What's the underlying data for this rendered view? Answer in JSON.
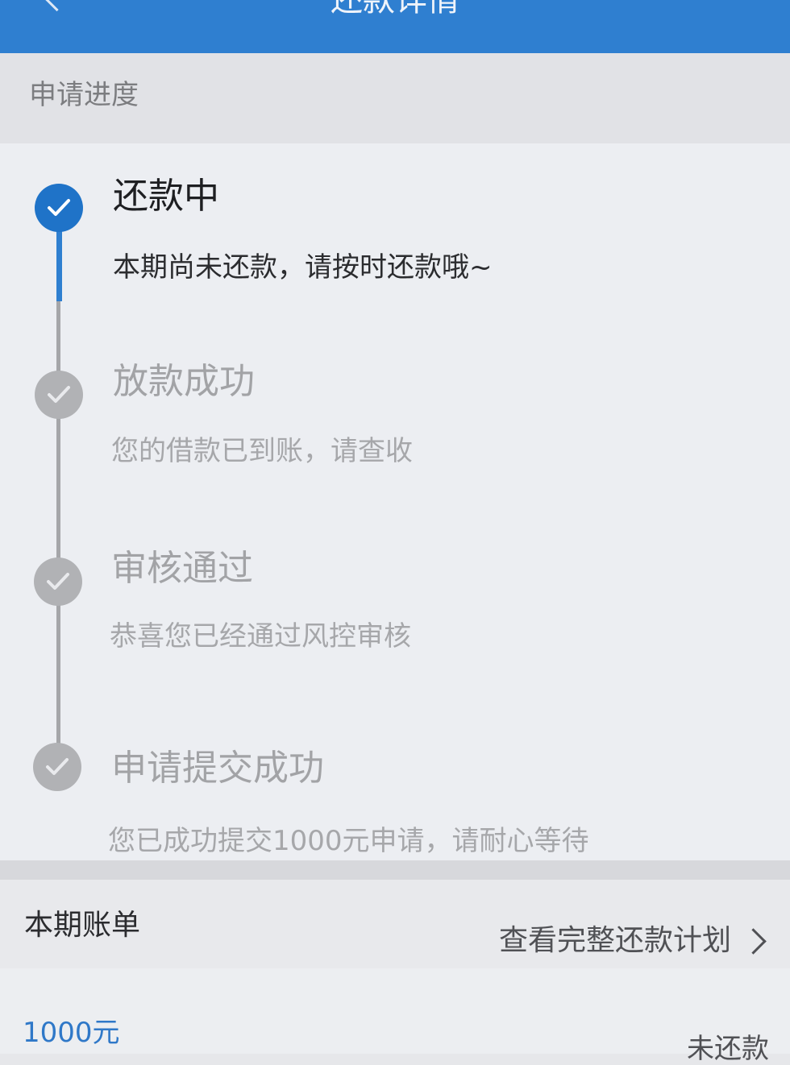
{
  "nav": {
    "title": "还款详情"
  },
  "progress": {
    "section_title": "申请进度",
    "steps": [
      {
        "title": "还款中",
        "desc": "本期尚未还款，请按时还款哦~"
      },
      {
        "title": "放款成功",
        "desc": "您的借款已到账，请查收"
      },
      {
        "title": "审核通过",
        "desc": "恭喜您已经通过风控审核"
      },
      {
        "title": "申请提交成功",
        "desc": "您已成功提交1000元申请，请耐心等待"
      }
    ]
  },
  "bill": {
    "title": "本期账单",
    "link_label": "查看完整还款计划",
    "amount": "1000元",
    "status": "未还款"
  },
  "colors": {
    "primary": "#2f7fd0",
    "inactive": "#b1b2b5"
  },
  "icons": [
    "back-arrow-icon",
    "check-icon",
    "chevron-right-icon"
  ]
}
